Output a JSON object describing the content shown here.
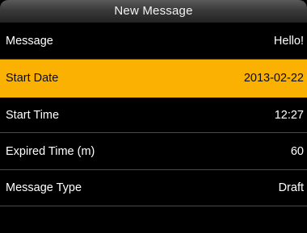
{
  "header": {
    "title": "New Message"
  },
  "menu": {
    "items": [
      {
        "label": "Message",
        "value": "Hello!"
      },
      {
        "label": "Start Date",
        "value": "2013-02-22",
        "selected": true
      },
      {
        "label": "Start Time",
        "value": "12:27"
      },
      {
        "label": "Expired Time (m)",
        "value": "60"
      },
      {
        "label": "Message Type",
        "value": "Draft"
      }
    ]
  },
  "colors": {
    "selected_background": "#fbb101",
    "background": "#000000",
    "divider": "#4a4a4a"
  }
}
